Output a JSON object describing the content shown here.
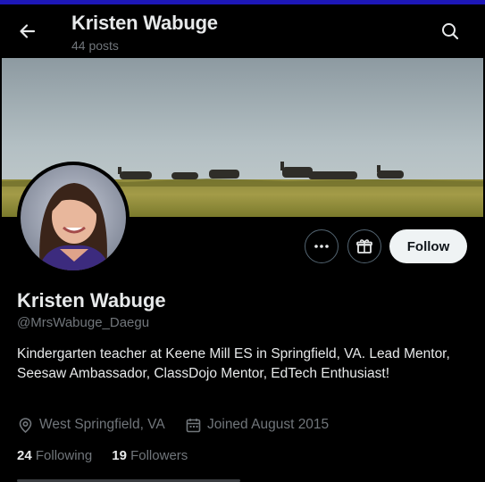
{
  "header": {
    "title": "Kristen Wabuge",
    "posts": "44 posts"
  },
  "profile": {
    "name": "Kristen Wabuge",
    "handle": "@MrsWabuge_Daegu",
    "bio": "Kindergarten teacher at Keene Mill ES in Springfield, VA. Lead Mentor, Seesaw Ambassador, ClassDojo Mentor, EdTech Enthusiast!",
    "location": "West Springfield, VA",
    "joined": "Joined August 2015"
  },
  "actions": {
    "follow_label": "Follow"
  },
  "stats": {
    "following_count": "24",
    "following_label": "Following",
    "followers_count": "19",
    "followers_label": "Followers"
  },
  "icons": {
    "back": "arrow-left-icon",
    "search": "search-icon",
    "more": "more-horizontal-icon",
    "gift": "gift-icon",
    "location": "location-pin-icon",
    "calendar": "calendar-icon"
  },
  "colors": {
    "accent_bar": "#1d17b8",
    "follow_bg": "#eff3f4",
    "muted": "#71767b"
  }
}
